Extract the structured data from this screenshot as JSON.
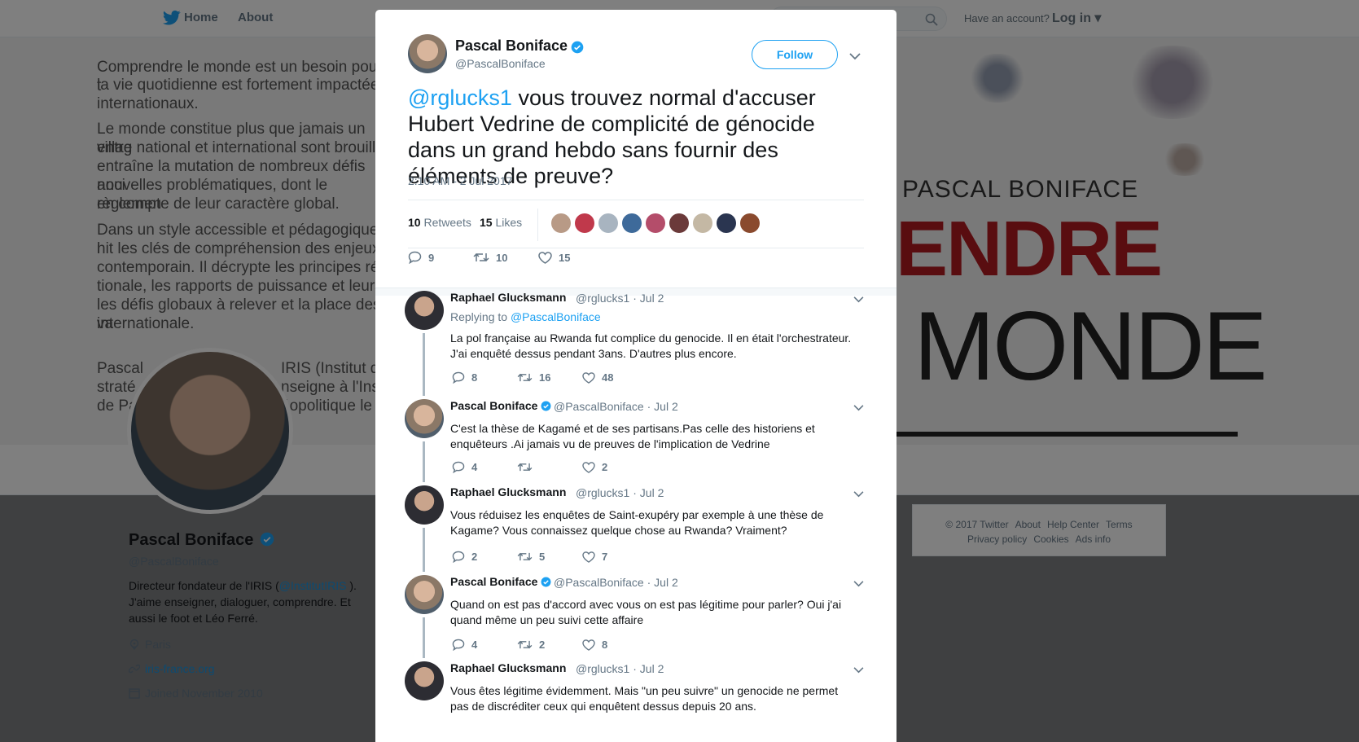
{
  "topnav": {
    "home": "Home",
    "about": "About",
    "have_account": "Have an account?",
    "login": "Log in"
  },
  "background": {
    "banner_text": [
      "Comprendre le monde est un besoin pour t",
      "la vie quotidienne est fortement impactée",
      "internationaux.",
      "Le monde constitue plus que jamais un villag",
      "entre national et international sont brouillé",
      "entraîne la mutation de nombreux défis anci",
      "nouvelles problématiques, dont le règlemen",
      "en compte de leur caractère global.",
      "Dans un style accessible et pédagogique, l",
      "nit les clés de compréhension des enjeux",
      "contemporain. Il décrypte les principes rég",
      "tionale, les rapports de puissance et leurs",
      "les défis globaux à relever et la place des va",
      "internationale."
    ],
    "banner_text_extra": [
      "Pascal",
      "IRIS (Institut de re",
      "straté",
      "nseigne à l'Insti",
      "de Pa",
      "éopolitique le p"
    ],
    "cover": {
      "author": "PASCAL BONIFACE",
      "word1": "ENDRE",
      "word2": "MONDE"
    },
    "profile": {
      "name": "Pascal Boniface",
      "handle": "@PascalBoniface",
      "bio_1": "Directeur fondateur de l'IRIS (",
      "bio_link": "@InstitutIRIS",
      "bio_2": " ). J'aime enseigner, dialoguer, comprendre. Et aussi le foot et Léo Ferré.",
      "location": "Paris",
      "website": "iris-france.org",
      "joined": "Joined November 2010"
    },
    "footer": [
      "© 2017 Twitter",
      "About",
      "Help Center",
      "Terms",
      "Privacy policy",
      "Cookies",
      "Ads info"
    ]
  },
  "tweet": {
    "author_name": "Pascal Boniface",
    "author_handle": "@PascalBoniface",
    "follow_label": "Follow",
    "mention": "@rglucks1",
    "text": " vous trouvez normal d'accuser Hubert Vedrine de complicité de génocide dans un grand hebdo sans fournir des éléments de preuve?",
    "timestamp": "2:10 AM - 2 Jul 2017",
    "retweets_count": "10",
    "retweets_label": "Retweets",
    "likes_count": "15",
    "likes_label": "Likes",
    "replies": "9",
    "retweets": "10",
    "likes": "15"
  },
  "replies": [
    {
      "name": "Raphael Glucksmann",
      "handle": "@rglucks1 · Jul 2",
      "replying_prefix": "Replying to ",
      "replying_to": "@PascalBoniface",
      "text": "La pol française au Rwanda fut complice du genocide. Il en était l'orchestrateur. J'ai enquêté dessus pendant 3ans. D'autres plus encore.",
      "replies": "8",
      "retweets": "16",
      "likes": "48"
    },
    {
      "name": "Pascal Boniface",
      "handle": "@PascalBoniface · Jul 2",
      "text": "C'est la thèse de Kagamé et de ses partisans.Pas celle des historiens et enquêteurs .Ai jamais vu de preuves de l'implication de Vedrine",
      "replies": "4",
      "retweets": "",
      "likes": "2"
    },
    {
      "name": "Raphael Glucksmann",
      "handle": "@rglucks1 · Jul 2",
      "text": "Vous réduisez les enquêtes de Saint-exupéry par exemple à une thèse de Kagame? Vous connaissez quelque chose au Rwanda? Vraiment?",
      "replies": "2",
      "retweets": "5",
      "likes": "7"
    },
    {
      "name": "Pascal Boniface",
      "handle": "@PascalBoniface · Jul 2",
      "text": "Quand on est pas d'accord avec vous on est pas légitime pour parler? Oui j'ai quand même un peu suivi cette affaire",
      "replies": "4",
      "retweets": "2",
      "likes": "8"
    },
    {
      "name": "Raphael Glucksmann",
      "handle": "@rglucks1 · Jul 2",
      "text": "Vous êtes légitime évidemment. Mais \"un peu suivre\" un genocide ne permet pas de discréditer ceux qui enquêtent dessus depuis 20 ans."
    }
  ],
  "colors": {
    "twitter_blue": "#1da1f2",
    "text": "#14171a",
    "muted": "#657786",
    "cover_red": "#b21a20"
  }
}
